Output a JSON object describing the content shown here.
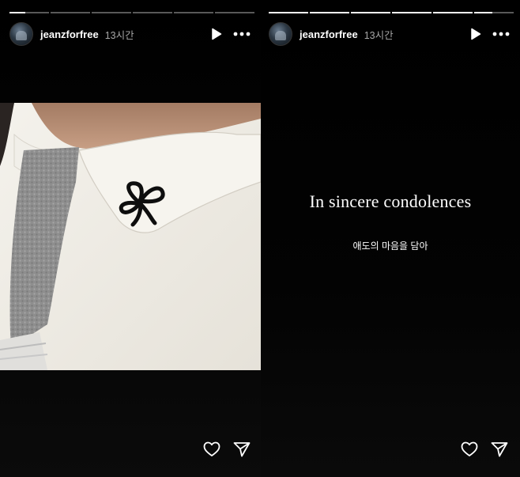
{
  "stories": [
    {
      "username": "jeanzforfree",
      "time": "13시간",
      "progress": {
        "segments": 6,
        "active_index": 0,
        "active_fraction": 0.4
      },
      "icons": {
        "play": "play-icon",
        "more": "more-options-icon",
        "like": "heart-icon",
        "share": "send-icon"
      }
    },
    {
      "username": "jeanzforfree",
      "time": "13시간",
      "progress": {
        "segments": 6,
        "active_index": 5,
        "active_fraction": 0.45
      },
      "title": "In sincere condolences",
      "subtitle": "애도의 마음을 담아",
      "icons": {
        "play": "play-icon",
        "more": "more-options-icon",
        "like": "heart-icon",
        "share": "send-icon"
      }
    }
  ]
}
